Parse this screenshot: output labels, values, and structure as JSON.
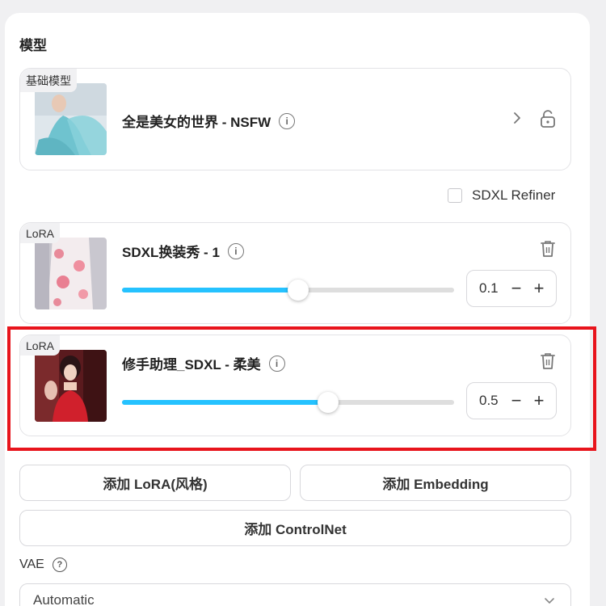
{
  "section_title": "模型",
  "base_model": {
    "badge": "基础模型",
    "name": "全是美女的世界 - NSFW"
  },
  "refiner": {
    "label": "SDXL Refiner",
    "checked": false
  },
  "loras": [
    {
      "badge": "LoRA",
      "name": "SDXL换装秀 - 1",
      "weight": "0.1",
      "slider_fraction": 0.53
    },
    {
      "badge": "LoRA",
      "name": "修手助理_SDXL - 柔美",
      "weight": "0.5",
      "slider_fraction": 0.62
    }
  ],
  "buttons": {
    "add_lora": "添加 LoRA(风格)",
    "add_embedding": "添加 Embedding",
    "add_controlnet": "添加 ControlNet"
  },
  "vae": {
    "label": "VAE",
    "selected": "Automatic"
  },
  "colors": {
    "accent": "#25c2ff",
    "highlight": "#e8141c"
  },
  "icons": [
    "info-icon",
    "chevron-right-icon",
    "unlock-icon",
    "trash-icon",
    "help-icon",
    "chevron-down-icon"
  ]
}
